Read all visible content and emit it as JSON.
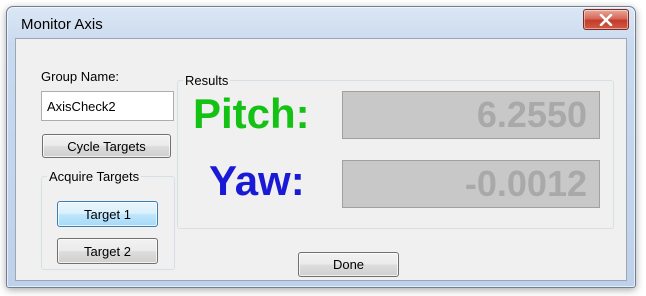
{
  "window": {
    "title": "Monitor Axis",
    "close_icon": "close-x-icon"
  },
  "left_panel": {
    "group_name_label": "Group Name:",
    "group_name_value": "AxisCheck2",
    "cycle_targets_label": "Cycle Targets",
    "acquire_group_title": "Acquire Targets",
    "target1_label": "Target 1",
    "target2_label": "Target 2"
  },
  "results": {
    "title": "Results",
    "pitch_label": "Pitch:",
    "pitch_value": "6.2550",
    "yaw_label": "Yaw:",
    "yaw_value": "-0.0012"
  },
  "done_label": "Done",
  "colors": {
    "pitch": "#13c213",
    "yaw": "#1a1ad6",
    "readout_bg": "#c8c8c8",
    "readout_text": "#a9a9a9"
  }
}
